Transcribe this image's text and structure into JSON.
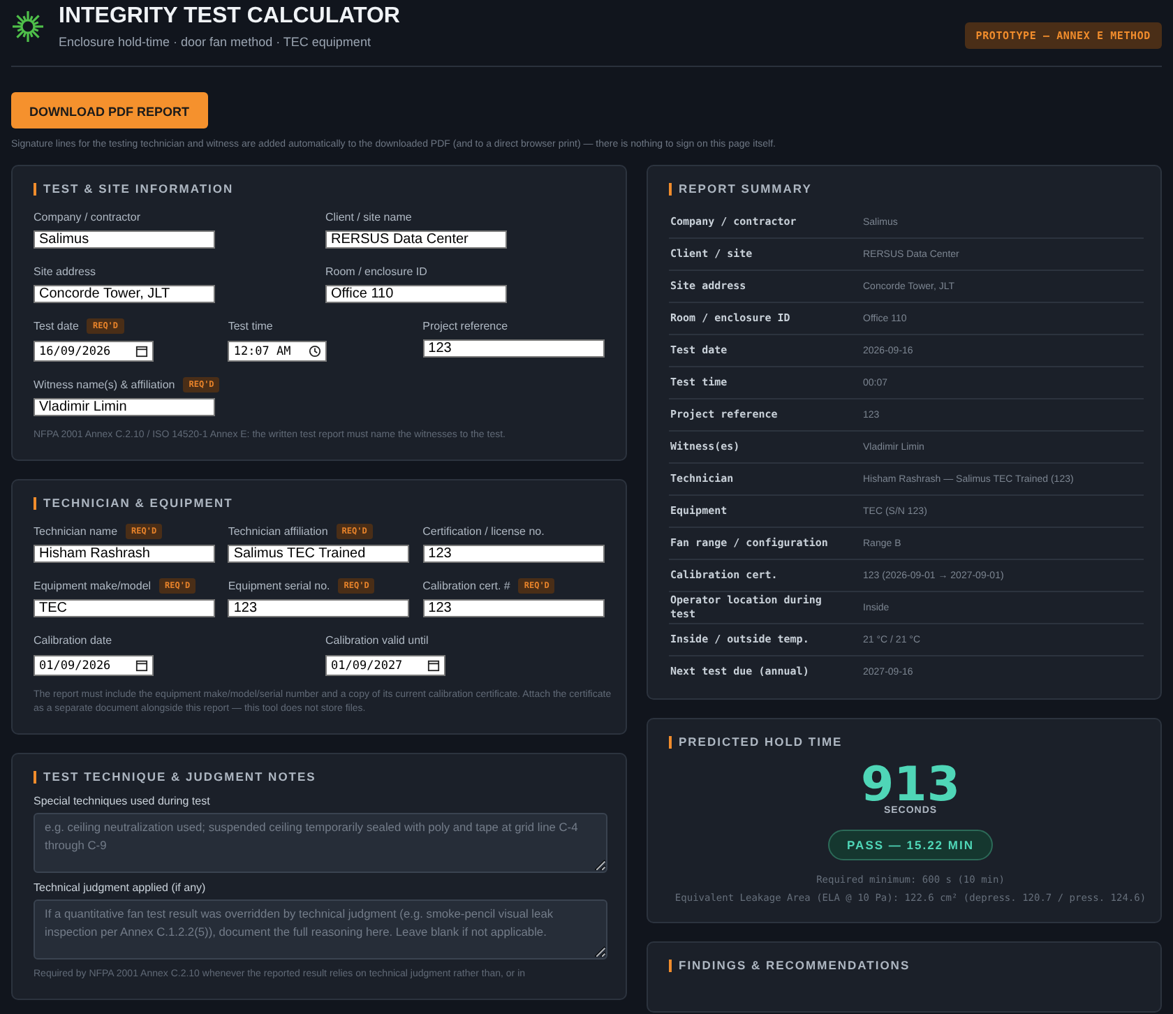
{
  "header": {
    "title": "INTEGRITY TEST CALCULATOR",
    "subtitle": "Enclosure hold-time · door fan method · TEC equipment",
    "badge": "PROTOTYPE — ANNEX E METHOD"
  },
  "download_button": "DOWNLOAD PDF REPORT",
  "signature_note": "Signature lines for the testing technician and witness are added automatically to the downloaded PDF (and to a direct browser print) — there is nothing to sign on this page itself.",
  "test_site": {
    "title": "TEST & SITE INFORMATION",
    "rows": [
      [
        {
          "label": "Company / contractor",
          "kind": "text",
          "value": "Salimus"
        },
        {
          "label": "Client / site name",
          "kind": "text",
          "value": "RERSUS Data Center"
        }
      ],
      [
        {
          "label": "Site address",
          "kind": "text",
          "value": "Concorde Tower, JLT"
        },
        {
          "label": "Room / enclosure ID",
          "kind": "text",
          "value": "Office 110"
        }
      ],
      [
        {
          "label": "Test date",
          "badge": "REQ'D",
          "kind": "date",
          "value": "16/09/2026"
        },
        {
          "label": "Test time",
          "kind": "time",
          "value": "12:07 AM"
        },
        {
          "label": "Project reference",
          "kind": "text",
          "value": "123"
        }
      ],
      [
        {
          "label": "Witness name(s) & affiliation",
          "badge": "REQ'D",
          "kind": "text",
          "value": "Vladimir Limin"
        }
      ]
    ],
    "note": "NFPA 2001 Annex C.2.10 / ISO 14520-1 Annex E: the written test report must name the witnesses to the test."
  },
  "technician": {
    "title": "TECHNICIAN & EQUIPMENT",
    "rows": [
      [
        {
          "label": "Technician name",
          "badge": "REQ'D",
          "kind": "text",
          "value": "Hisham Rashrash"
        },
        {
          "label": "Technician affiliation",
          "badge": "REQ'D",
          "kind": "text",
          "value": "Salimus TEC Trained"
        },
        {
          "label": "Certification / license no.",
          "kind": "text",
          "value": "123"
        }
      ],
      [
        {
          "label": "Equipment make/model",
          "badge": "REQ'D",
          "kind": "text",
          "value": "TEC"
        },
        {
          "label": "Equipment serial no.",
          "badge": "REQ'D",
          "kind": "text",
          "value": "123"
        },
        {
          "label": "Calibration cert. #",
          "badge": "REQ'D",
          "kind": "text",
          "value": "123"
        }
      ],
      [
        {
          "label": "Calibration date",
          "kind": "date",
          "value": "01/09/2026"
        },
        {
          "label": "Calibration valid until",
          "kind": "date",
          "value": "01/09/2027"
        }
      ]
    ],
    "note": "The report must include the equipment make/model/serial number and a copy of its current calibration certificate. Attach the certificate as a separate document alongside this report — this tool does not store files."
  },
  "notes": {
    "title": "TEST TECHNIQUE & JUDGMENT NOTES",
    "fields": [
      {
        "label": "Special techniques used during test",
        "placeholder": "e.g. ceiling neutralization used; suspended ceiling temporarily sealed with poly and tape at grid line C-4 through C-9"
      },
      {
        "label": "Technical judgment applied (if any)",
        "placeholder": "If a quantitative fan test result was overridden by technical judgment (e.g. smoke-pencil visual leak inspection per Annex C.1.2.2(5)), document the full reasoning here. Leave blank if not applicable."
      }
    ],
    "note": "Required by NFPA 2001 Annex C.2.10 whenever the reported result relies on technical judgment rather than, or in"
  },
  "summary": {
    "title": "REPORT SUMMARY",
    "rows": [
      {
        "key": "Company / contractor",
        "value": "Salimus"
      },
      {
        "key": "Client / site",
        "value": "RERSUS Data Center"
      },
      {
        "key": "Site address",
        "value": "Concorde Tower, JLT"
      },
      {
        "key": "Room / enclosure ID",
        "value": "Office 110"
      },
      {
        "key": "Test date",
        "value": "2026-09-16"
      },
      {
        "key": "Test time",
        "value": "00:07"
      },
      {
        "key": "Project reference",
        "value": "123"
      },
      {
        "key": "Witness(es)",
        "value": "Vladimir Limin"
      },
      {
        "key": "Technician",
        "value": "Hisham Rashrash — Salimus TEC Trained (123)"
      },
      {
        "key": "Equipment",
        "value": "TEC (S/N 123)"
      },
      {
        "key": "Fan range / configuration",
        "value": "Range B"
      },
      {
        "key": "Calibration cert.",
        "value": "123 (2026-09-01 → 2027-09-01)"
      },
      {
        "key": "Operator location during test",
        "value": "Inside"
      },
      {
        "key": "Inside / outside temp.",
        "value": "21 °C / 21 °C"
      },
      {
        "key": "Next test due (annual)",
        "value": "2027-09-16"
      }
    ]
  },
  "hold_time": {
    "title": "PREDICTED HOLD TIME",
    "value": "913",
    "unit": "SECONDS",
    "result": {
      "passed": true,
      "label": "PASS — 15.22 MIN"
    },
    "required": "Required minimum: 600 s (10 min)",
    "ela": "Equivalent Leakage Area (ELA @ 10 Pa): 122.6 cm² (depress. 120.7 / press. 124.6)"
  },
  "findings": {
    "title": "FINDINGS & RECOMMENDATIONS"
  }
}
